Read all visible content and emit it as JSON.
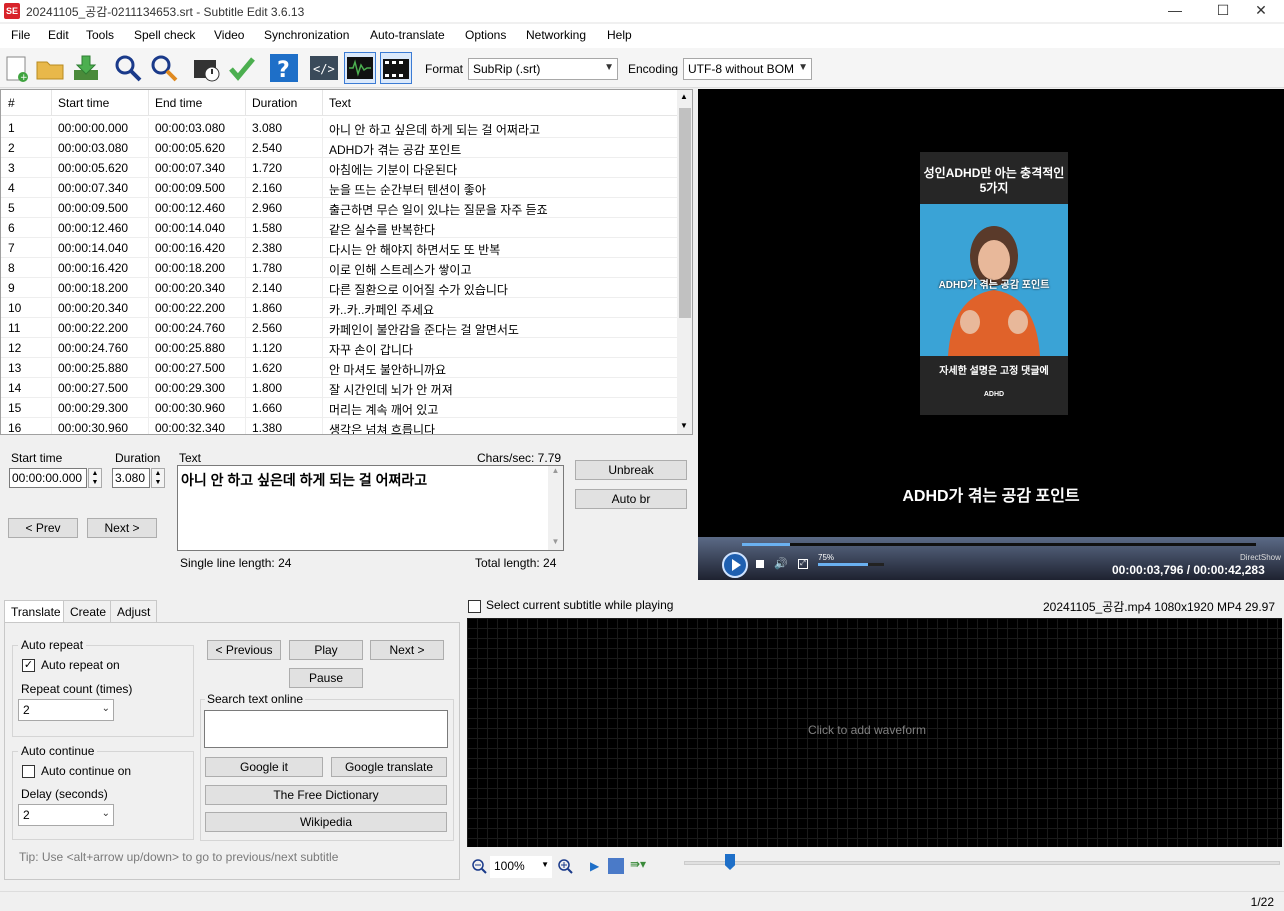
{
  "window": {
    "title": "20241105_공감-0211134653.srt - Subtitle Edit 3.6.13",
    "app_icon": "SE",
    "minimize": "—",
    "maximize": "☐",
    "close": "✕"
  },
  "menu": [
    "File",
    "Edit",
    "Tools",
    "Spell check",
    "Video",
    "Synchronization",
    "Auto-translate",
    "Options",
    "Networking",
    "Help"
  ],
  "toolbar": {
    "format_label": "Format",
    "format_value": "SubRip (.srt)",
    "encoding_label": "Encoding",
    "encoding_value": "UTF-8 without BOM"
  },
  "grid": {
    "headers": [
      "#",
      "Start time",
      "End time",
      "Duration",
      "Text"
    ],
    "rows": [
      [
        "1",
        "00:00:00.000",
        "00:00:03.080",
        "3.080",
        "아니 안 하고 싶은데 하게 되는 걸 어쩌라고"
      ],
      [
        "2",
        "00:00:03.080",
        "00:00:05.620",
        "2.540",
        "ADHD가 겪는 공감 포인트"
      ],
      [
        "3",
        "00:00:05.620",
        "00:00:07.340",
        "1.720",
        "아침에는 기분이 다운된다"
      ],
      [
        "4",
        "00:00:07.340",
        "00:00:09.500",
        "2.160",
        "눈을 뜨는 순간부터 텐션이 좋아"
      ],
      [
        "5",
        "00:00:09.500",
        "00:00:12.460",
        "2.960",
        "출근하면 무슨 일이 있냐는 질문을 자주 듣죠"
      ],
      [
        "6",
        "00:00:12.460",
        "00:00:14.040",
        "1.580",
        "같은 실수를 반복한다"
      ],
      [
        "7",
        "00:00:14.040",
        "00:00:16.420",
        "2.380",
        "다시는 안 해야지 하면서도 또 반복"
      ],
      [
        "8",
        "00:00:16.420",
        "00:00:18.200",
        "1.780",
        "이로 인해 스트레스가 쌓이고"
      ],
      [
        "9",
        "00:00:18.200",
        "00:00:20.340",
        "2.140",
        "다른 질환으로 이어질 수가 있습니다"
      ],
      [
        "10",
        "00:00:20.340",
        "00:00:22.200",
        "1.860",
        "카..카..카페인 주세요"
      ],
      [
        "11",
        "00:00:22.200",
        "00:00:24.760",
        "2.560",
        "카페인이 불안감을 준다는 걸 알면서도"
      ],
      [
        "12",
        "00:00:24.760",
        "00:00:25.880",
        "1.120",
        "자꾸 손이 갑니다"
      ],
      [
        "13",
        "00:00:25.880",
        "00:00:27.500",
        "1.620",
        "안 마셔도 불안하니까요"
      ],
      [
        "14",
        "00:00:27.500",
        "00:00:29.300",
        "1.800",
        "잘 시간인데 뇌가 안 꺼져"
      ],
      [
        "15",
        "00:00:29.300",
        "00:00:30.960",
        "1.660",
        "머리는 계속 깨어 있고"
      ],
      [
        "16",
        "00:00:30.960",
        "00:00:32.340",
        "1.380",
        "생각은 넘쳐 흐릅니다"
      ]
    ]
  },
  "edit": {
    "start_label": "Start time",
    "start_value": "00:00:00.000",
    "duration_label": "Duration",
    "duration_value": "3.080",
    "text_label": "Text",
    "chars_sec": "Chars/sec: 7.79",
    "text_value": "아니 안 하고 싶은데 하게 되는 걸 어쩌라고",
    "prev": "< Prev",
    "next": "Next >",
    "unbreak": "Unbreak",
    "auto_br": "Auto br",
    "single_line": "Single line length: 24",
    "total_length": "Total length: 24"
  },
  "video": {
    "frame_title": "성인ADHD만 아는 충격적인 5가지",
    "frame_caption": "ADHD가 겪는 공감 포인트",
    "frame_bottom": "자세한 설명은 고정 댓글에",
    "frame_logo": "ADHD",
    "subtitle": "ADHD가 겪는 공감 포인트",
    "volume": "75%",
    "renderer": "DirectShow",
    "time": "00:00:03,796 / 00:00:42,283"
  },
  "tabs": [
    "Translate",
    "Create",
    "Adjust"
  ],
  "translate": {
    "auto_repeat_group": "Auto repeat",
    "auto_repeat_on": "Auto repeat on",
    "repeat_count_label": "Repeat count (times)",
    "repeat_count_value": "2",
    "auto_continue_group": "Auto continue",
    "auto_continue_on": "Auto continue on",
    "delay_label": "Delay (seconds)",
    "delay_value": "2",
    "previous": "< Previous",
    "play": "Play",
    "next": "Next >",
    "pause": "Pause",
    "search_online": "Search text online",
    "google_it": "Google it",
    "google_translate": "Google translate",
    "free_dictionary": "The Free Dictionary",
    "wikipedia": "Wikipedia",
    "tip": "Tip: Use <alt+arrow up/down> to go to previous/next subtitle"
  },
  "waveform": {
    "select_current": "Select current subtitle while playing",
    "media_info": "20241105_공감.mp4 1080x1920 MP4 29.97",
    "click_label": "Click to add waveform",
    "zoom": "100%"
  },
  "status": {
    "position": "1/22"
  }
}
